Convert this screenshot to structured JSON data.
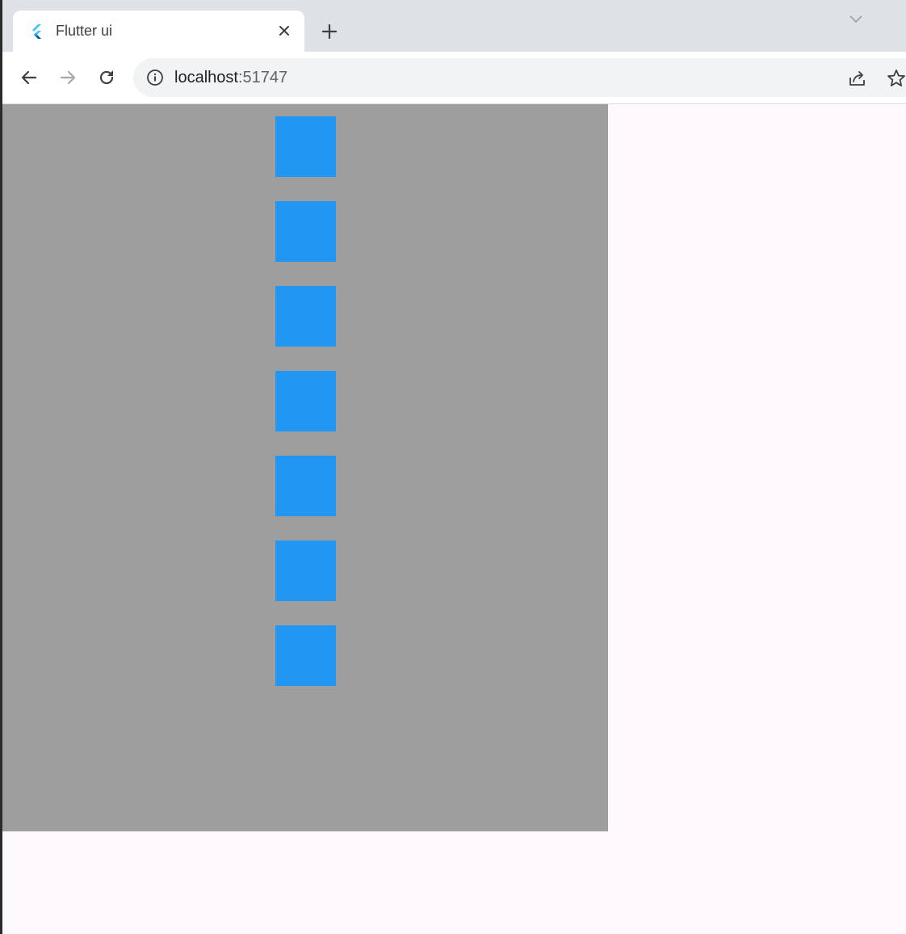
{
  "browser": {
    "tab": {
      "title": "Flutter ui",
      "favicon": "flutter-logo-icon",
      "close_icon": "close-icon"
    },
    "new_tab_icon": "plus-icon",
    "tab_search_icon": "chevron-down-icon",
    "toolbar": {
      "back_icon": "back-arrow-icon",
      "forward_icon": "forward-arrow-icon",
      "reload_icon": "reload-icon",
      "site_info_icon": "info-icon",
      "url_host": "localhost",
      "url_port": ":51747",
      "share_icon": "share-icon",
      "bookmark_icon": "star-icon"
    }
  },
  "app": {
    "container_color": "#9e9e9e",
    "box_color": "#2196f3",
    "page_background": "#fef9fd",
    "box_count": 7
  }
}
